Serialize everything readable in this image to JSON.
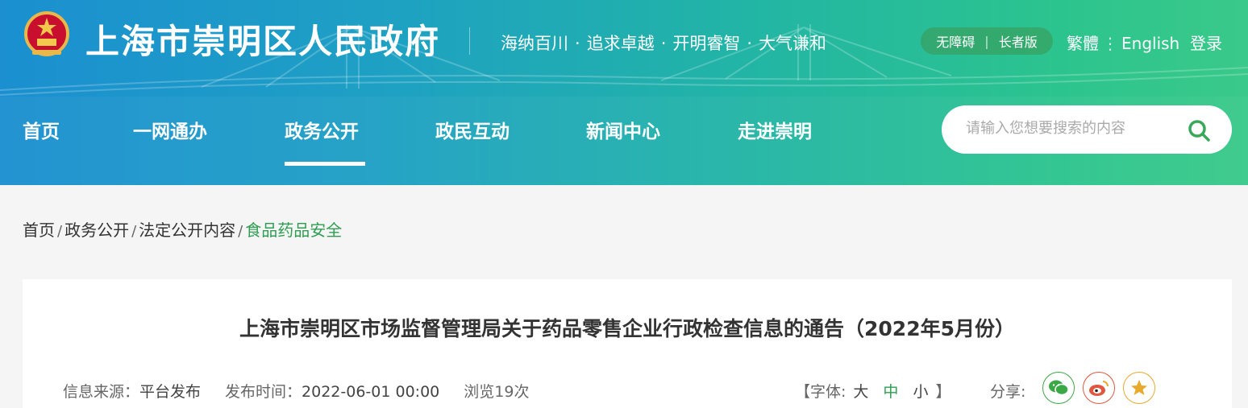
{
  "header": {
    "site_title": "上海市崇明区人民政府",
    "slogan": [
      "海纳百川",
      "追求卓越",
      "开明睿智",
      "大气谦和"
    ],
    "slogan_separator": "·",
    "accessibility": "无障碍",
    "elderly": "长者版",
    "pill_separator": "|",
    "traditional": "繁體",
    "lang_separator": "⋮",
    "english": "English",
    "login": "登录",
    "gradient_colors": [
      "#1b8fd0",
      "#22b5a5",
      "#3ac98a"
    ]
  },
  "nav": {
    "items": [
      "首页",
      "一网通办",
      "政务公开",
      "政民互动",
      "新闻中心",
      "走进崇明"
    ],
    "active": "政务公开"
  },
  "search": {
    "placeholder": "请输入您想要搜索的内容",
    "icon": "search-icon",
    "icon_color": "#3aa85a"
  },
  "breadcrumb": {
    "items": [
      "首页",
      "政务公开",
      "法定公开内容",
      "食品药品安全"
    ],
    "separator": "/",
    "current_color": "#2e9e52"
  },
  "article": {
    "title": "上海市崇明区市场监督管理局关于药品零售企业行政检查信息的通告（2022年5月份）",
    "source_label": "信息来源：",
    "source_value": "平台发布",
    "time_label": "发布时间：",
    "time_value": "2022-06-01 00:00",
    "views": "浏览19次",
    "font_label_open": "【字体:",
    "font_large": "大",
    "font_medium": "中",
    "font_small": "小",
    "font_label_close": "】",
    "share_label": "分享:",
    "share_icons": [
      {
        "name": "wechat-icon",
        "color": "#3aa845"
      },
      {
        "name": "weibo-icon",
        "color": "#e0563e"
      },
      {
        "name": "favorite-star-icon",
        "color": "#e8a92c"
      }
    ]
  }
}
